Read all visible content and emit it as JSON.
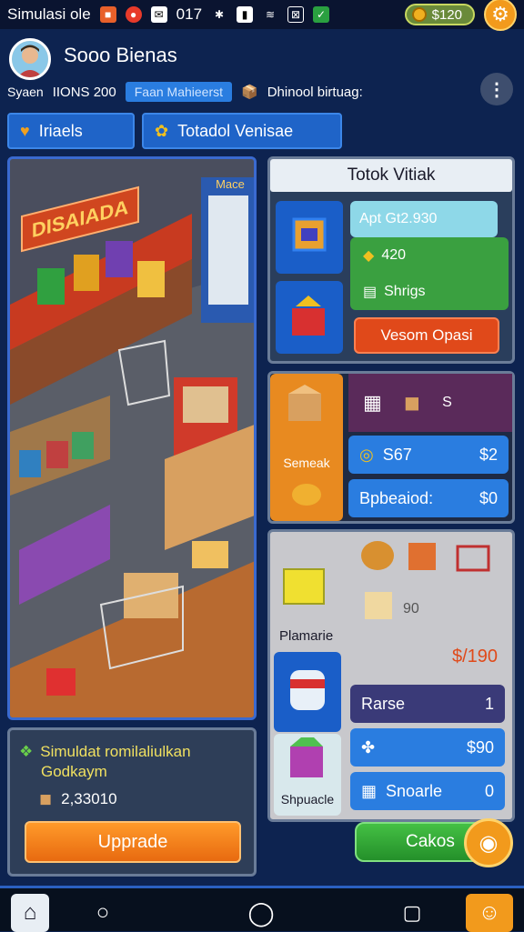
{
  "status_bar": {
    "app_label": "Simulasi ole",
    "time": "017",
    "coins": "$120"
  },
  "header": {
    "title": "Sooo Bienas",
    "subtitle_left": "Syaen",
    "stat_text": "IIONS 200",
    "pill_label": "Faan Mahieerst",
    "right_text": "Dhinool birtuag:"
  },
  "tabs": [
    {
      "label": "Iriaels",
      "icon": "heart-icon"
    },
    {
      "label": "Totadol Venisae",
      "icon": "bag-icon"
    }
  ],
  "scene": {
    "sign_text": "DISAIADA",
    "side_sign": "Mace"
  },
  "shop_panel": {
    "title": "Totok Vitiak",
    "price_header": "Apt Gt2.930",
    "item_1": "420",
    "item_2": "Shrigs",
    "button": "Vesom Opasi"
  },
  "stock_panel": {
    "top_value": "S",
    "label": "Semeak",
    "row_1_left": "S67",
    "row_1_right": "$2",
    "row_2_left": "Bpbeaiod:",
    "row_2_right": "$0"
  },
  "market_panel": {
    "label_a": "Plamarie",
    "value_a": "90",
    "price": "$/190",
    "label_b": "Shpuacle",
    "rows": [
      {
        "label": "Rarse",
        "value": "1"
      },
      {
        "label": "",
        "value": "$90"
      },
      {
        "label": "Snoarle",
        "value": "0"
      }
    ]
  },
  "bottom_panel": {
    "line_1": "Simuldat romilaliulkan",
    "line_2": "Godkaym",
    "amount": "2,33010",
    "upgrade_label": "Upprade"
  },
  "cakes_button": "Cakos",
  "colors": {
    "background": "#0d2350",
    "accent_blue": "#1f64c8",
    "accent_orange": "#f29a1c",
    "accent_red": "#e0491a",
    "accent_green": "#2aa040"
  }
}
